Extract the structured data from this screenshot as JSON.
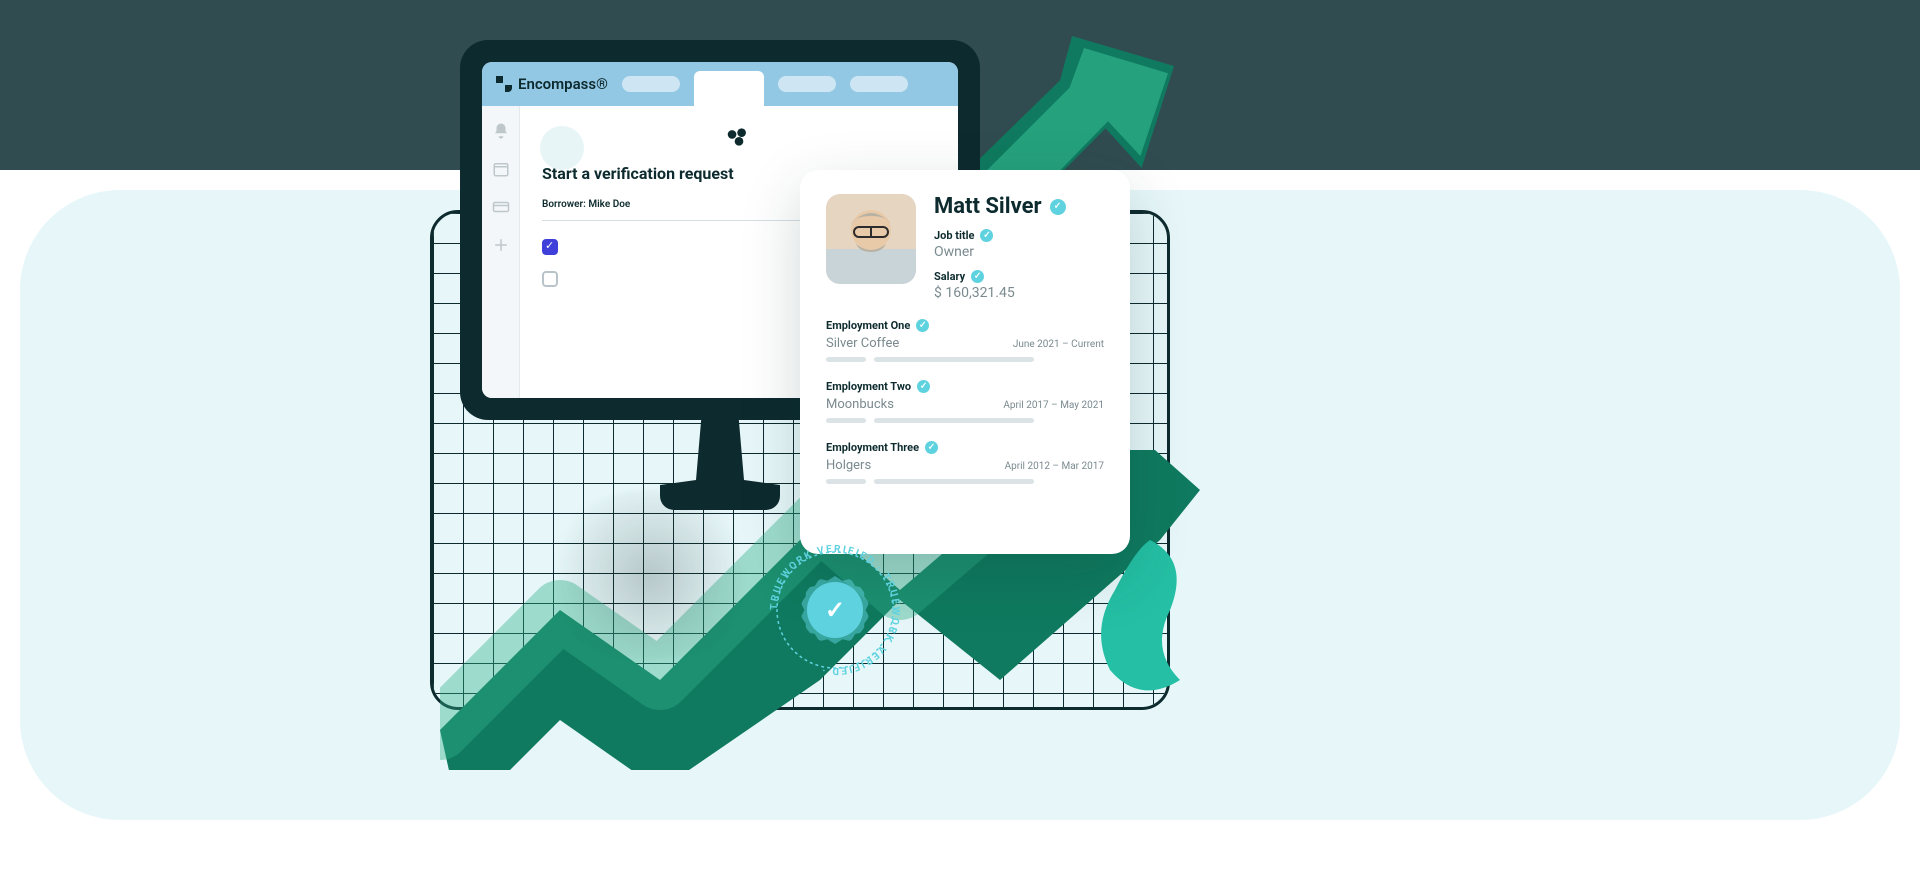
{
  "brand": {
    "name": "Encompass®"
  },
  "page": {
    "title": "Start a verification request",
    "borrower_label": "Borrower:",
    "borrower_name": "Mike Doe"
  },
  "profile": {
    "name": "Matt Silver",
    "job_title_label": "Job title",
    "job_title": "Owner",
    "salary_label": "Salary",
    "salary": "$ 160,321.45",
    "employments": [
      {
        "label": "Employment One",
        "company": "Silver Coffee",
        "dates": "June 2021 – Current"
      },
      {
        "label": "Employment Two",
        "company": "Moonbucks",
        "dates": "April 2017 – May 2021"
      },
      {
        "label": "Employment Three",
        "company": "Holgers",
        "dates": "April 2012 – Mar 2017"
      }
    ]
  },
  "stamp": {
    "text": "TRUEWORK VERIFIED · TRUEWORK VERIFIED · "
  }
}
